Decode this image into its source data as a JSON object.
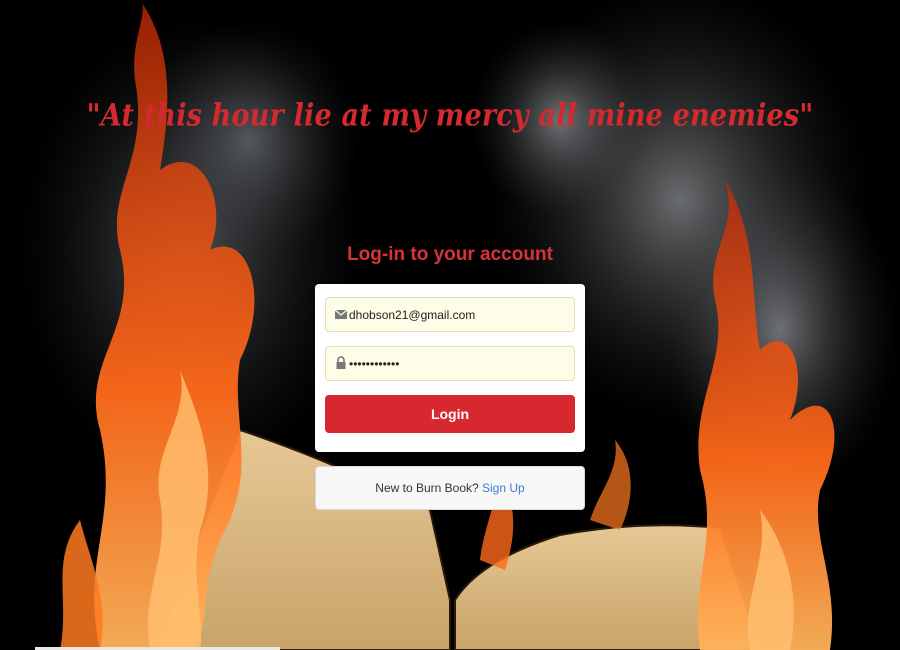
{
  "quote": "\"At this hour lie at my mercy all mine enemies\"",
  "login": {
    "heading": "Log-in to your account",
    "email_value": "dhobson21@gmail.com",
    "password_value": "••••••••••••",
    "button_label": "Login",
    "email_icon": "envelope-icon",
    "password_icon": "lock-icon"
  },
  "signup": {
    "prompt": "New to Burn Book?",
    "link_label": "Sign Up"
  },
  "colors": {
    "accent": "#d8282f",
    "quote": "#d42a2f",
    "link": "#3a7fd0",
    "field_bg": "#fdfde8"
  }
}
